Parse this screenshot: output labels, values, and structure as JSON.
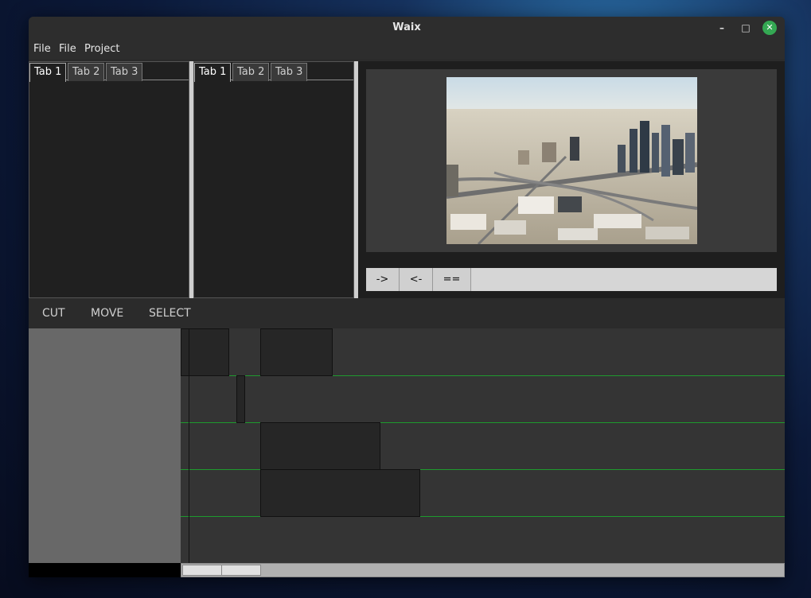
{
  "window": {
    "title": "Waix",
    "minimize_glyph": "–",
    "maximize_glyph": "□",
    "close_glyph": "✕"
  },
  "menu": {
    "items": [
      "File",
      "File",
      "Project"
    ]
  },
  "left_panel_tabs": [
    "Tab 1",
    "Tab 2",
    "Tab 3"
  ],
  "right_panel_tabs": [
    "Tab 1",
    "Tab 2",
    "Tab 3"
  ],
  "preview": {
    "image_alt": "aerial city skyline",
    "controls": [
      "->",
      "<-",
      "=="
    ]
  },
  "tools": [
    "CUT",
    "MOVE",
    "SELECT"
  ],
  "colors": {
    "accent_close": "#34a853",
    "lane_line": "#1e9a2e"
  }
}
